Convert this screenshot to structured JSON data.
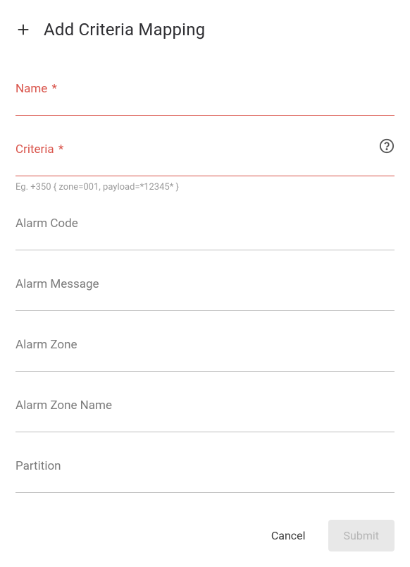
{
  "header": {
    "title": "Add Criteria Mapping",
    "icon": "plus-icon"
  },
  "fields": {
    "name": {
      "label": "Name",
      "required": true,
      "value": "",
      "error": true
    },
    "criteria": {
      "label": "Criteria",
      "required": true,
      "value": "",
      "error": true,
      "hint": "Eg. +350 { zone=001, payload=*12345* }",
      "help_icon": "help-icon"
    },
    "alarm_code": {
      "label": "Alarm Code",
      "value": ""
    },
    "alarm_message": {
      "label": "Alarm Message",
      "value": ""
    },
    "alarm_zone": {
      "label": "Alarm Zone",
      "value": ""
    },
    "alarm_zone_name": {
      "label": "Alarm Zone Name",
      "value": ""
    },
    "partition": {
      "label": "Partition",
      "value": ""
    }
  },
  "actions": {
    "cancel_label": "Cancel",
    "submit_label": "Submit",
    "submit_disabled": true
  },
  "colors": {
    "error": "#d9534a",
    "text_muted": "#7a7a7a",
    "text_hint": "#9a9a9a",
    "divider": "#bdbdbd",
    "disabled_bg": "#e8e8e8",
    "disabled_text": "#b5b5b5"
  }
}
